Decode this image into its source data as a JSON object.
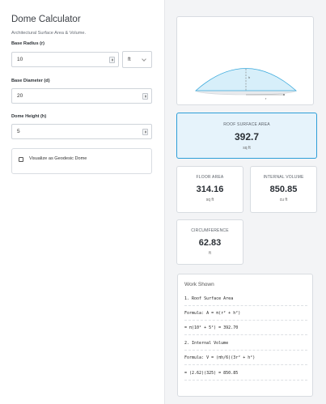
{
  "calculator": {
    "title": "Dome Calculator",
    "subtitle": "Architectural Surface Area & Volume."
  },
  "form": {
    "radius": {
      "label": "Base Radius (r)",
      "value": "10"
    },
    "unit": {
      "selected": "ft"
    },
    "diameter": {
      "label": "Base Diameter (d)",
      "value": "20"
    },
    "height": {
      "label": "Dome Height (h)",
      "value": "5"
    },
    "geodesic": {
      "label": "Visualize as Geodesic Dome",
      "checked": false
    }
  },
  "diagram": {
    "height_label": "h",
    "radius_label": "r",
    "colors": {
      "dome_fill": "#d7effa",
      "dome_stroke": "#39a9dc",
      "base": "#cfd3d8"
    }
  },
  "results": {
    "roof": {
      "label": "ROOF SURFACE AREA",
      "value": "392.7",
      "unit": "sq ft"
    },
    "floor": {
      "label": "FLOOR AREA",
      "value": "314.16",
      "unit": "sq ft"
    },
    "volume": {
      "label": "INTERNAL VOLUME",
      "value": "850.85",
      "unit": "cu ft"
    },
    "circumference": {
      "label": "CIRCUMFERENCE",
      "value": "62.83",
      "unit": "ft"
    }
  },
  "work": {
    "title": "Work Shown",
    "lines": [
      "1. Roof Surface Area",
      "Formula: A = π(r² + h²)",
      "= π(10² + 5²) = 392.70",
      "2. Internal Volume",
      "Formula: V = (πh/6)(3r² + h²)",
      "= (2.62)(325) = 850.85"
    ]
  },
  "theme": {
    "accent": "#2d9ed8",
    "highlight_bg": "#e6f3fb",
    "panel_bg": "#f3f4f6"
  }
}
